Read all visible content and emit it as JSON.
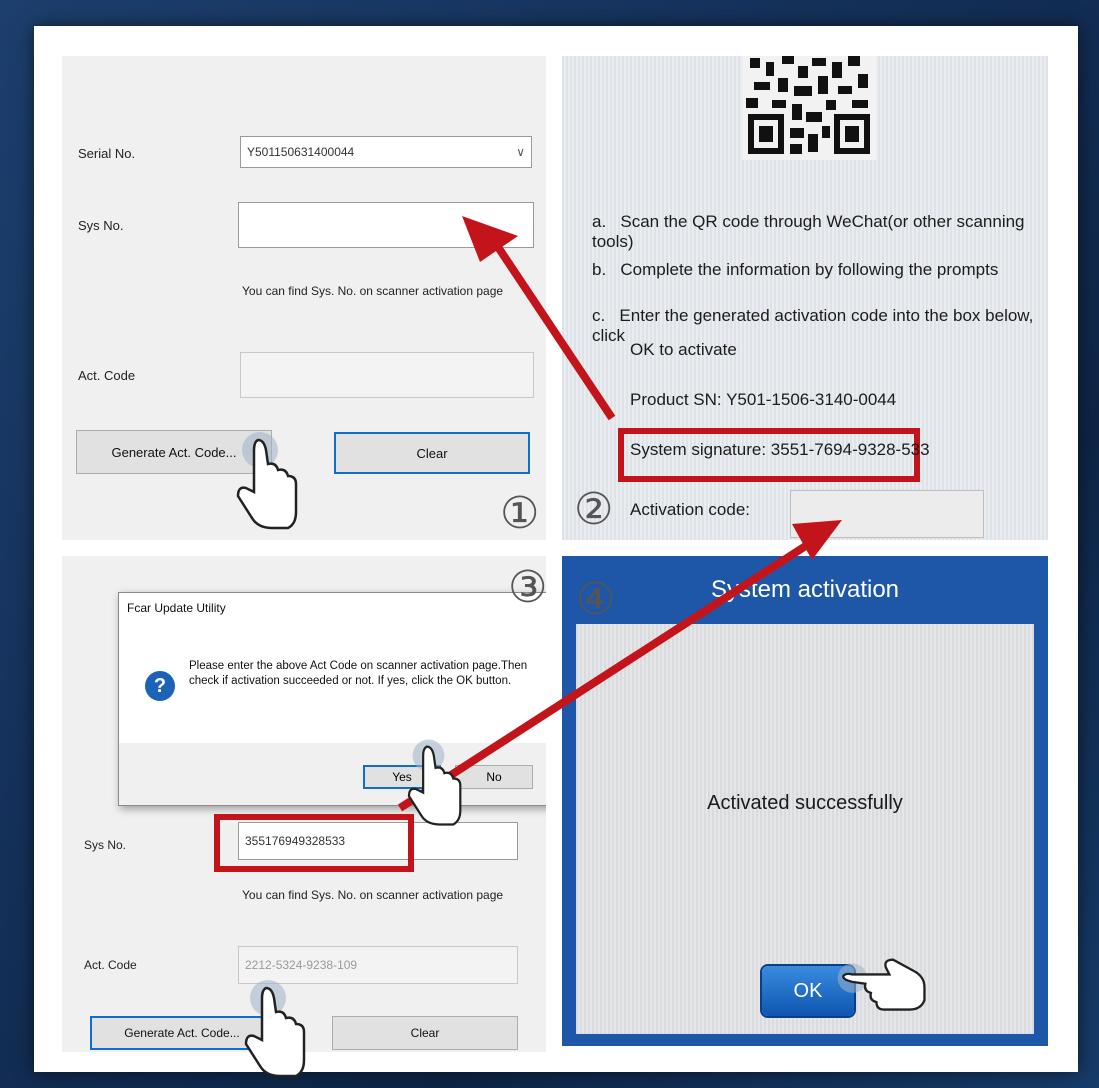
{
  "colors": {
    "arrow_red": "#c4141b",
    "accent_blue": "#1f57a8",
    "focus_blue": "#0a6fd0"
  },
  "step1": {
    "step_number": "①",
    "serial_label": "Serial No.",
    "serial_value": "Y501150631400044",
    "sys_label": "Sys No.",
    "sys_value": "",
    "hint": "You can find Sys. No. on scanner activation page",
    "act_label": "Act. Code",
    "act_value": "",
    "generate_button": "Generate Act. Code...",
    "clear_button": "Clear"
  },
  "step2": {
    "step_number": "②",
    "instructions": [
      {
        "letter": "a.",
        "text": "Scan the QR code through WeChat(or other scanning tools)"
      },
      {
        "letter": "b.",
        "text": "Complete the information by following the prompts"
      },
      {
        "letter": "c.",
        "text": "Enter the generated activation code into the box below, click"
      },
      {
        "letter": "",
        "text": "OK to activate"
      }
    ],
    "product_sn": "Product SN: Y501-1506-3140-0044",
    "system_signature": "System signature: 3551-7694-9328-533",
    "activation_label": "Activation code:"
  },
  "step3": {
    "step_number": "③",
    "dialog_title": "Fcar Update Utility",
    "dialog_message": "Please enter the above Act Code on scanner activation page.Then check if activation succeeded or not. If  yes, click the OK button.",
    "yes_button": "Yes",
    "no_button": "No",
    "sys_label": "Sys No.",
    "sys_value": "355176949328533",
    "hint": "You can find Sys. No. on scanner activation page",
    "act_label": "Act. Code",
    "act_value": "2212-5324-9238-109",
    "generate_button": "Generate Act. Code...",
    "clear_button": "Clear"
  },
  "step4": {
    "step_number": "④",
    "title": "System activation",
    "message": "Activated successfully",
    "ok_button": "OK"
  }
}
